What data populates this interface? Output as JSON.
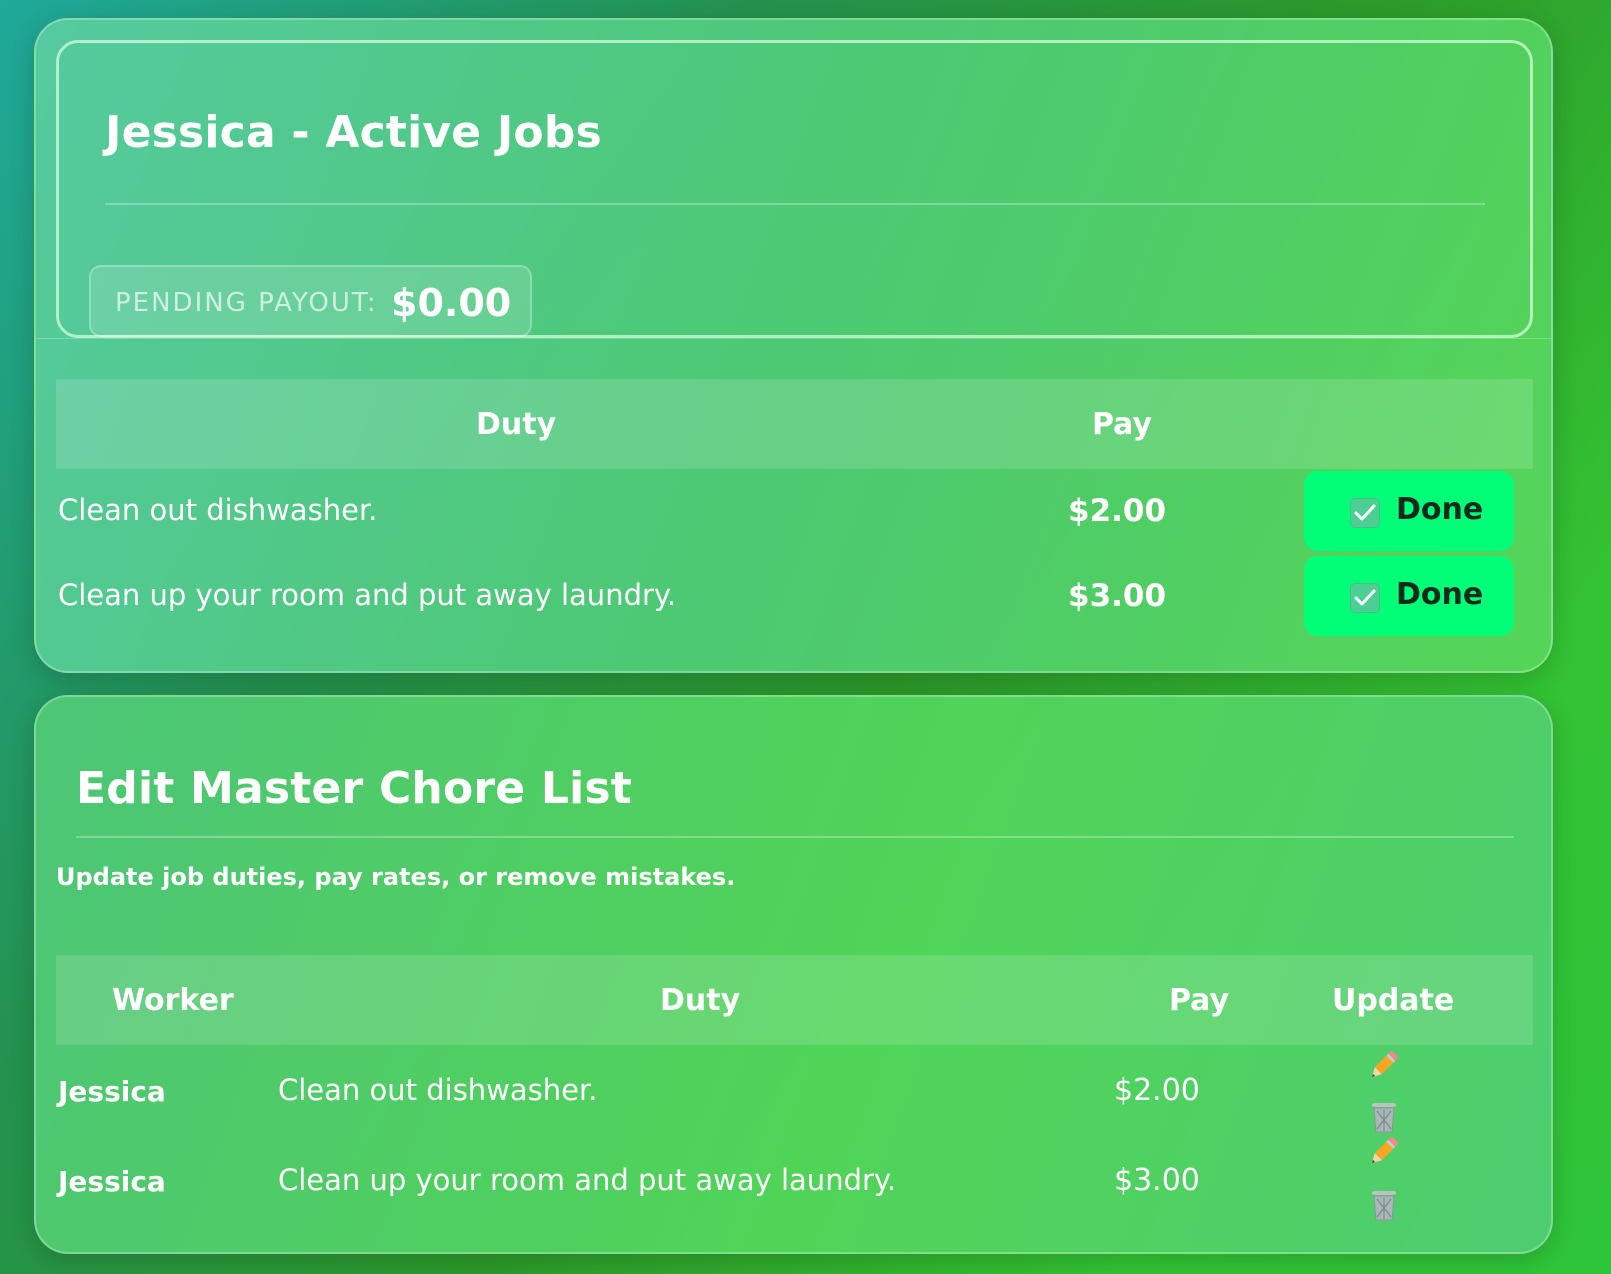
{
  "active_jobs": {
    "title": "Jessica - Active Jobs",
    "pending_payout_label": "PENDING PAYOUT:",
    "pending_payout_value": "$0.00",
    "columns": {
      "duty": "Duty",
      "pay": "Pay"
    },
    "rows": [
      {
        "duty": "Clean out dishwasher.",
        "pay": "$2.00",
        "action_label": "Done"
      },
      {
        "duty": "Clean up your room and put away laundry.",
        "pay": "$3.00",
        "action_label": "Done"
      }
    ]
  },
  "master_list": {
    "title": "Edit Master Chore List",
    "subtitle": "Update job duties, pay rates, or remove mistakes.",
    "columns": {
      "worker": "Worker",
      "duty": "Duty",
      "pay": "Pay",
      "update": "Update"
    },
    "rows": [
      {
        "worker": "Jessica",
        "duty": "Clean out dishwasher.",
        "pay": "$2.00",
        "edit_icon": "pencil-icon",
        "delete_icon": "wastebasket-icon"
      },
      {
        "worker": "Jessica",
        "duty": "Clean up your room and put away laundry.",
        "pay": "$3.00",
        "edit_icon": "pencil-icon",
        "delete_icon": "wastebasket-icon"
      }
    ]
  },
  "colors": {
    "done_button": "#00ff77",
    "done_text": "#0e2a1e",
    "text": "#ffffff"
  }
}
